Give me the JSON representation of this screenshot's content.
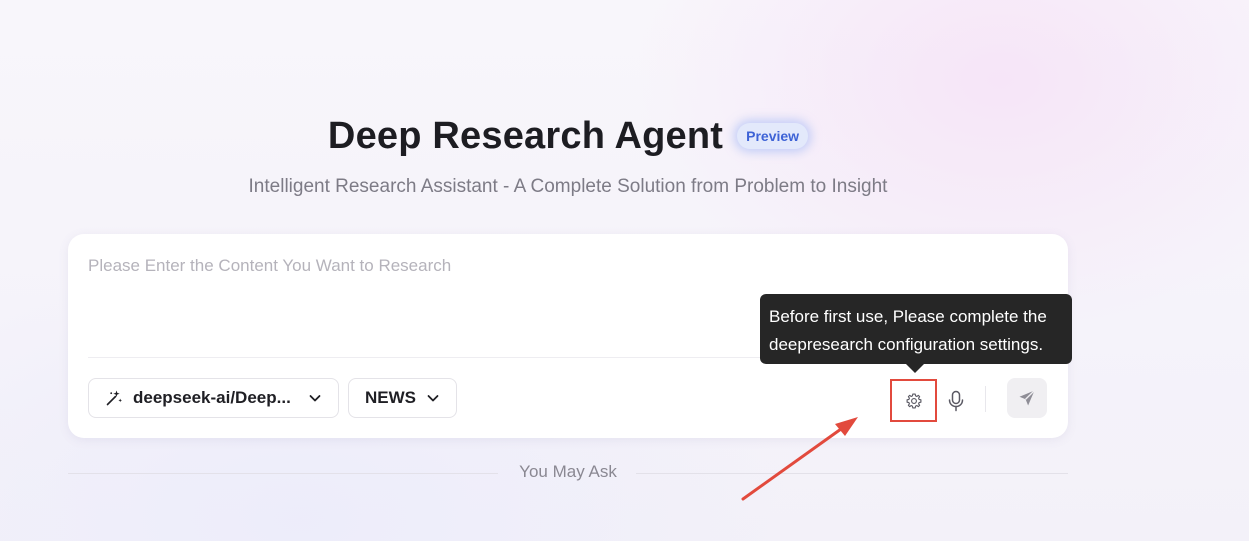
{
  "header": {
    "title": "Deep Research Agent",
    "badge": "Preview",
    "subtitle": "Intelligent Research Assistant - A Complete Solution from Problem to Insight"
  },
  "input": {
    "placeholder": "Please Enter the Content You Want to Research",
    "value": ""
  },
  "toolbar": {
    "model_label": "deepseek-ai/Deep...",
    "model_icon": "sparkle-icon",
    "source_label": "NEWS",
    "settings_icon": "gear-icon",
    "mic_icon": "microphone-icon",
    "send_icon": "send-icon"
  },
  "tooltip": {
    "text": "Before first use, Please complete the deepresearch configuration settings."
  },
  "suggestions": {
    "heading": "You May Ask"
  },
  "colors": {
    "accent_badge": "#3e63d6",
    "highlight": "#e24a3d",
    "tooltip_bg": "#262626"
  }
}
